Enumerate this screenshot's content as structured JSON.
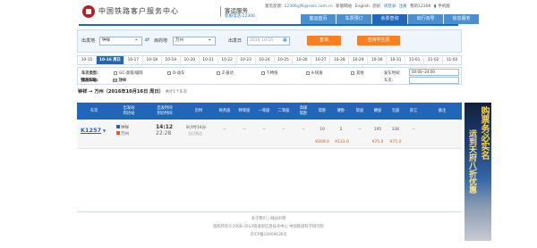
{
  "header": {
    "logo_title": "中国铁路客户服务中心",
    "service_title": "客运服务",
    "hotline": "客服电话:12306",
    "feedback_label": "意见反馈:",
    "feedback_email": "12306yjfk@rails.com.cn",
    "new_user": "新版网站",
    "language": "English",
    "login_prefix": "您好,",
    "username": "请登录",
    "register": "注册",
    "phone_label": "我的12306",
    "mobile": "手机版"
  },
  "nav": {
    "items": [
      "客运首页",
      "车票预订",
      "余票查询",
      "出行向导",
      "信息服务"
    ],
    "active_index": 2
  },
  "search": {
    "from_label": "出发地",
    "from_value": "钟祥",
    "swap_icon": "swap-icon",
    "to_label": "目的地",
    "to_value": "万州",
    "date_label": "出发日",
    "date_value": "2016-10-16",
    "query_button": "查询",
    "student_button": "查询学生票"
  },
  "dates": [
    "10-15",
    "10-16 周日",
    "10-17",
    "10-18",
    "10-19",
    "10-20",
    "10-21",
    "10-22",
    "10-23",
    "10-24",
    "10-25",
    "10-26",
    "10-27",
    "10-28",
    "10-29",
    "10-30",
    "10-31",
    "11-01",
    "11-02",
    "11-03"
  ],
  "active_date_index": 1,
  "filters": {
    "type_label": "车次类型:",
    "types": [
      "GC-高铁/城际",
      "D-动车",
      "Z-直达",
      "T-特快",
      "K-快速",
      "其他"
    ],
    "from_label": "出发车站:",
    "from_station": "钟祥",
    "to_label": "到达车站:",
    "to_station": "万州",
    "time_label": "发车时间:",
    "time_value": "00:00--24:00",
    "train_no_label": "车次:",
    "train_no_value": ""
  },
  "route": {
    "title": "钟祥 → 万州（2016年10月16日 周日）",
    "count": "共计1个车次"
  },
  "table": {
    "headers": [
      "车次",
      "出发站\n到达站",
      "出发时间\n到达时间",
      "历时",
      "商务座",
      "特等座",
      "一等座",
      "二等座",
      "高级\n软卧",
      "软卧",
      "硬卧",
      "软座",
      "硬座",
      "无座",
      "其它",
      "备注"
    ],
    "row": {
      "train": "K1257",
      "from_station": "钟祥",
      "to_station": "万州",
      "depart": "14:12",
      "arrive": "22:28",
      "duration": "8小时16分",
      "arrive_day": "当日到达",
      "business": "--",
      "special": "--",
      "first": "--",
      "second": "--",
      "adv_soft_sleeper": "--",
      "soft_sleeper": "10",
      "hard_sleeper": "2",
      "soft_seat": "--",
      "hard_seat": "195",
      "no_seat": "336",
      "other": "--",
      "note": "",
      "soft_sleeper_price": "¥209.0",
      "hard_sleeper_price": "¥133.0",
      "hard_seat_price": "¥75.0",
      "no_seat_price": "¥75.0"
    }
  },
  "ad": {
    "line1": "购票务必实名",
    "line2": "运到天府八折优惠"
  },
  "footer": {
    "links": "关于我们 | 网站声明",
    "copyright": "版权所有©2008-2013铁道部信息技术中心  中国铁道科学研究院",
    "icp": "京ICP备10009636号"
  },
  "colors": {
    "primary": "#2166b8",
    "accent": "#ff7e1d",
    "price": "#e35b16"
  }
}
